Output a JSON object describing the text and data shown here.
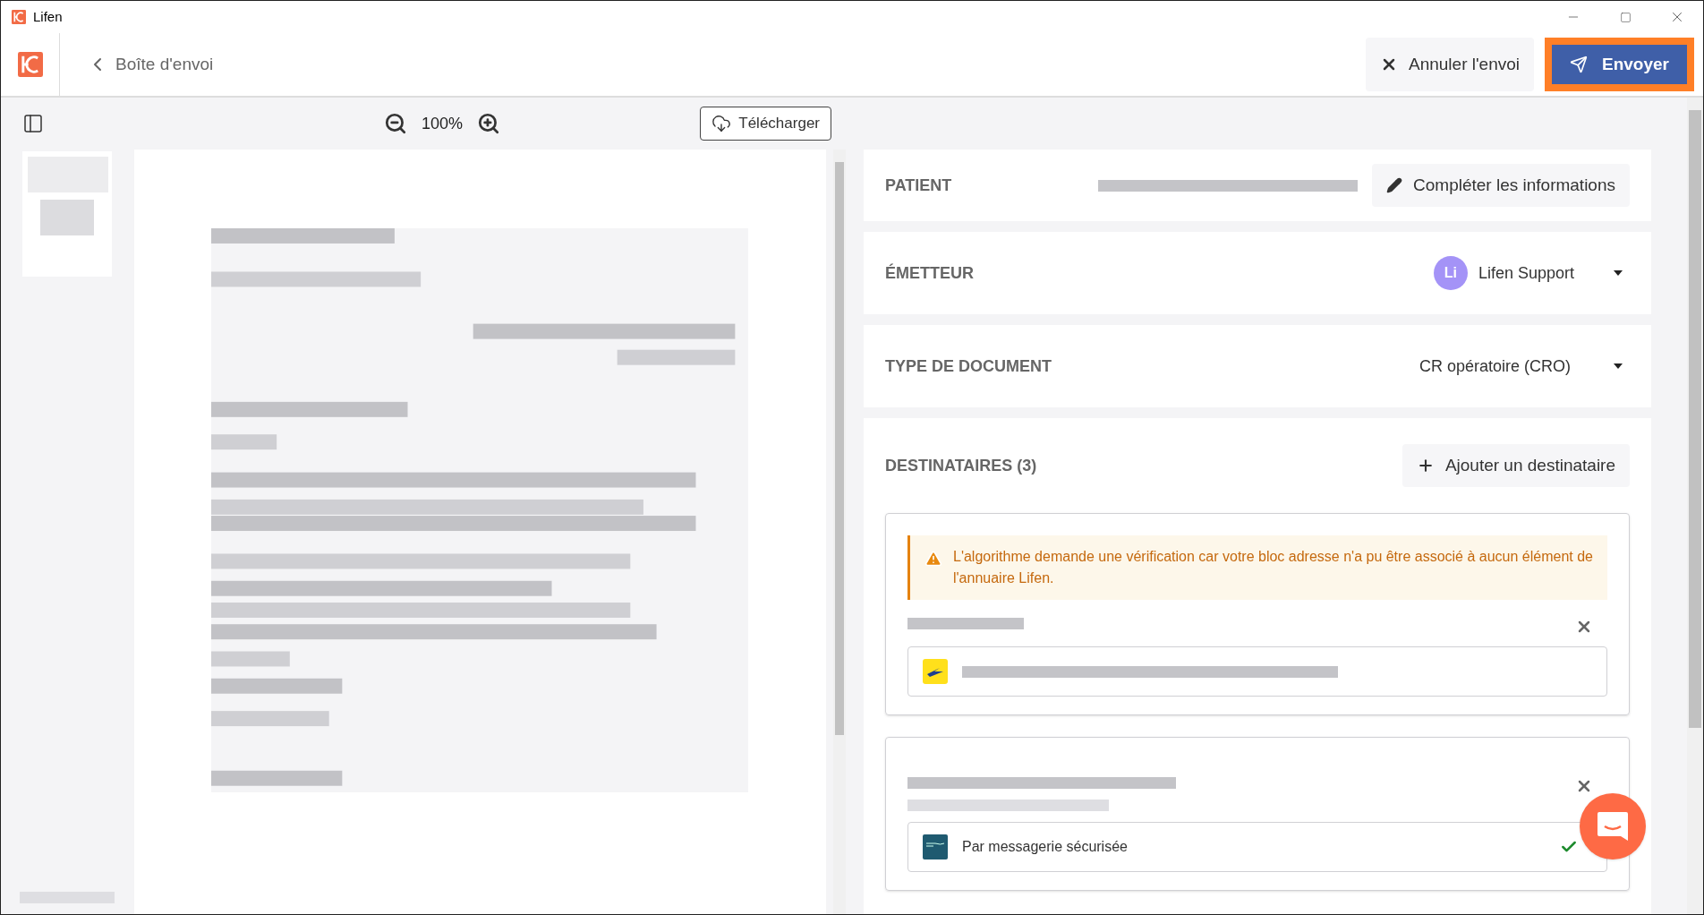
{
  "window": {
    "title": "Lifen"
  },
  "header": {
    "back_label": "Boîte d'envoi",
    "actions": [
      {
        "label": "Annuler l'envoi",
        "kind": "secondary"
      },
      {
        "label": "Envoyer",
        "kind": "primary"
      }
    ]
  },
  "viewer": {
    "zoom": "100%",
    "download": "Télécharger"
  },
  "patient": {
    "label": "PATIENT",
    "action": "Compléter les informations"
  },
  "sender": {
    "label": "ÉMETTEUR",
    "avatar": "Li",
    "name": "Lifen Support"
  },
  "document_type": {
    "label": "TYPE DE DOCUMENT",
    "value": "CR opératoire (CRO)"
  },
  "recipients": {
    "label": "DESTINATAIRES (3)",
    "add": "Ajouter un destinataire",
    "items": [
      {
        "kind": "postal",
        "warning": "L'algorithme demande une vérification car votre bloc adresse n'a pu être associé à aucun élément de l'annuaire Lifen."
      },
      {
        "kind": "secure",
        "channel": "Par messagerie sécurisée",
        "verified": true
      }
    ]
  }
}
